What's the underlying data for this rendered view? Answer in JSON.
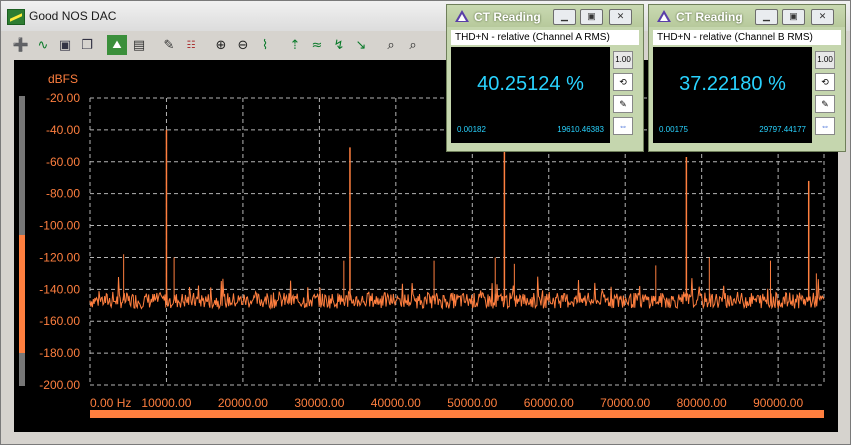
{
  "window": {
    "title": "Good NOS DAC"
  },
  "toolbar": {
    "icons": [
      "add-line-icon",
      "wave-icon",
      "save-icon",
      "copy-icon",
      "graph-green-icon",
      "graph-settings-icon",
      "edit-icon",
      "table-icon",
      "zoom-in-icon",
      "zoom-out-icon",
      "autoscale-icon",
      "cursor-a-icon",
      "cursor-b-icon",
      "cursor-c-icon",
      "cursor-d-icon",
      "find-peak-icon",
      "find-icon"
    ]
  },
  "plot": {
    "unit": "dBFS",
    "colors": {
      "trace": "#ff7f3f",
      "grid": "#b5b5b5",
      "background": "#000000"
    }
  },
  "chart_data": {
    "type": "line",
    "ylabel": "dBFS",
    "xlabel": "",
    "ylim": [
      -200,
      -20
    ],
    "xlim": [
      0,
      96000
    ],
    "yticks": [
      "-20.00",
      "-40.00",
      "-60.00",
      "-80.00",
      "-100.00",
      "-120.00",
      "-140.00",
      "-160.00",
      "-180.00",
      "-200.00"
    ],
    "xticks": [
      "0.00 Hz",
      "10000.00",
      "20000.00",
      "30000.00",
      "40000.00",
      "50000.00",
      "60000.00",
      "70000.00",
      "80000.00",
      "90000.00"
    ],
    "grid": true,
    "series": [
      {
        "noise_floor_db": -147,
        "noise_range_db": [
          -155,
          -132
        ],
        "peaks": [
          {
            "x": 10000,
            "y": -40
          },
          {
            "x": 34000,
            "y": -51
          },
          {
            "x": 54200,
            "y": -32
          },
          {
            "x": 78000,
            "y": -57
          },
          {
            "x": 94000,
            "y": -72
          }
        ],
        "minor_peaks": [
          {
            "x": 4400,
            "y": -118
          },
          {
            "x": 11000,
            "y": -120
          },
          {
            "x": 33200,
            "y": -122
          },
          {
            "x": 45000,
            "y": -122
          },
          {
            "x": 53000,
            "y": -120
          },
          {
            "x": 55500,
            "y": -124
          },
          {
            "x": 74000,
            "y": -125
          },
          {
            "x": 81000,
            "y": -120
          },
          {
            "x": 89000,
            "y": -122
          },
          {
            "x": 95000,
            "y": -130
          }
        ]
      }
    ]
  },
  "ct_a": {
    "title": "CT Reading",
    "subtitle": "THD+N - relative (Channel A RMS)",
    "value": "40.25124 %",
    "min": "0.00182",
    "max": "19610.46383"
  },
  "ct_b": {
    "title": "CT Reading",
    "subtitle": "THD+N - relative (Channel B RMS)",
    "value": "37.22180 %",
    "min": "0.00175",
    "max": "29797.44177"
  },
  "ct_side_buttons": {
    "range_label": "1.00"
  }
}
